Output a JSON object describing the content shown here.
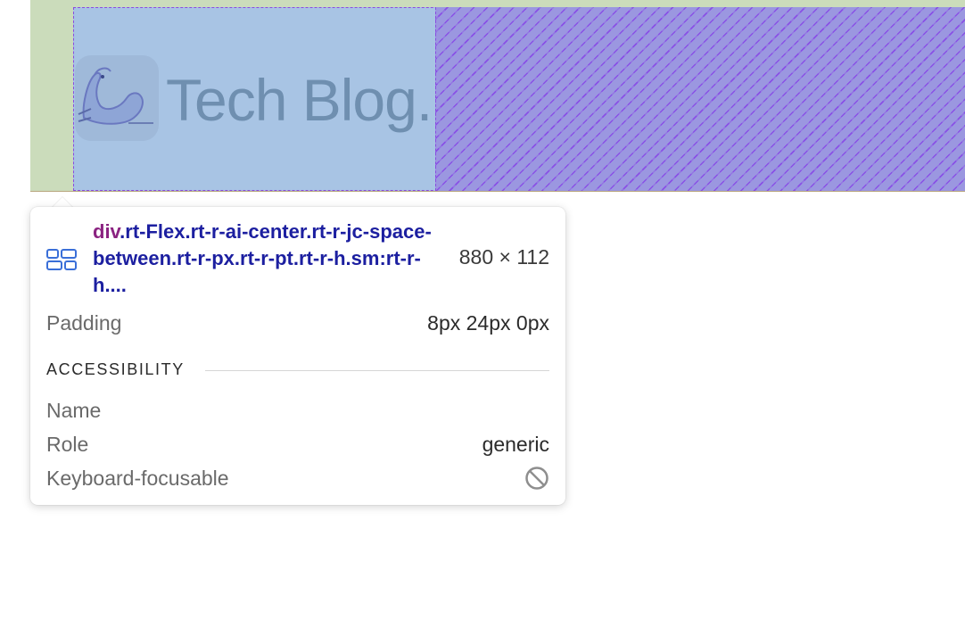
{
  "header": {
    "blog_title": "Tech Blog."
  },
  "tooltip": {
    "selector_tag": "div",
    "selector_classes": ".rt-Flex.rt-r-ai-center.rt-r-jc-space-between.rt-r-px.rt-r-pt.rt-r-h.sm:rt-r-h....",
    "dimensions": "880 × 112",
    "padding_label": "Padding",
    "padding_value": "8px 24px 0px",
    "accessibility_heading": "ACCESSIBILITY",
    "name_label": "Name",
    "name_value": "",
    "role_label": "Role",
    "role_value": "generic",
    "focusable_label": "Keyboard-focusable",
    "icons": {
      "layout": "flex-layout-icon",
      "focusable": "not-allowed-icon"
    }
  },
  "colors": {
    "padding_overlay": "#cbdcbb",
    "content_overlay": "#a8c4e4",
    "free_space_overlay": "#9b97e0",
    "dashed_outline": "#8a4be0",
    "selector_tag": "#8b2381",
    "selector_class": "#1c1fa0"
  }
}
